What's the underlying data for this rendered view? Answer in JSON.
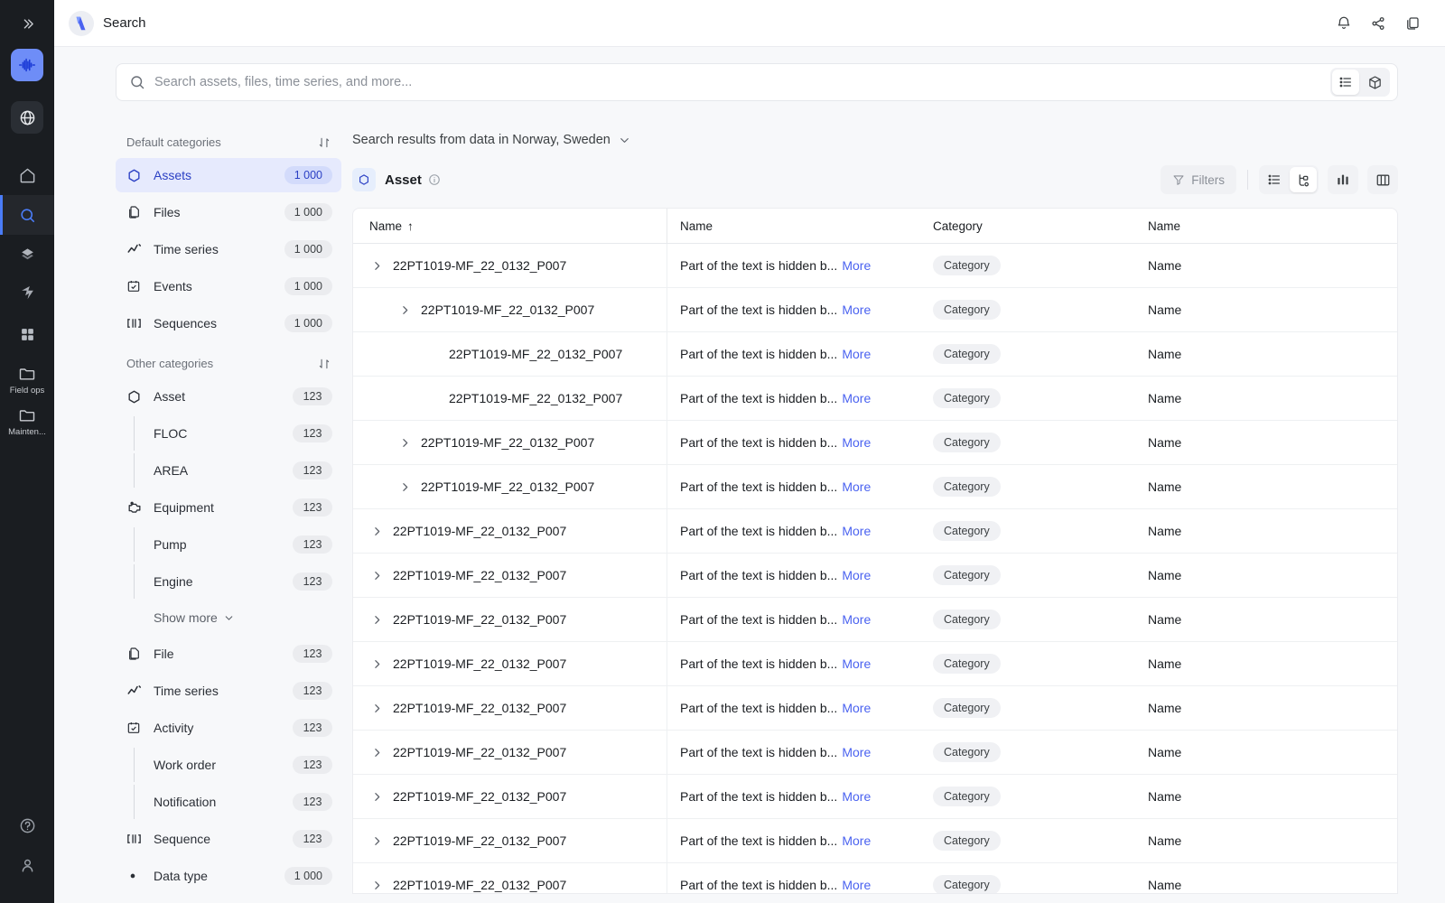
{
  "rail": {
    "collapse_icon": "chevrons-right-icon",
    "brand_icon": "cognite-brand-icon",
    "globe_icon": "globe-icon",
    "items": [
      {
        "icon": "home-icon",
        "name": "home",
        "active": false
      },
      {
        "icon": "search-icon",
        "name": "search",
        "active": true
      },
      {
        "icon": "layers-icon",
        "name": "layers",
        "active": false
      },
      {
        "icon": "activity-icon",
        "name": "activity",
        "active": false
      },
      {
        "icon": "grid-icon",
        "name": "apps",
        "active": false
      }
    ],
    "folders": [
      {
        "label": "Field ops",
        "icon": "folder-icon"
      },
      {
        "label": "Mainten...",
        "icon": "folder-icon"
      }
    ],
    "bottom": [
      {
        "icon": "help-icon",
        "name": "help"
      },
      {
        "icon": "user-icon",
        "name": "profile"
      }
    ]
  },
  "topbar": {
    "title": "Search",
    "logo_icon": "cognite-logo-icon",
    "actions": [
      {
        "icon": "bell-icon",
        "name": "notifications"
      },
      {
        "icon": "share-icon",
        "name": "share"
      },
      {
        "icon": "copy-icon",
        "name": "files"
      }
    ]
  },
  "search": {
    "placeholder": "Search assets, files, time series, and more...",
    "value": "",
    "icon": "search-icon",
    "view_toggle": [
      {
        "icon": "list-icon",
        "name": "list-view",
        "active": true
      },
      {
        "icon": "cube-icon",
        "name": "3d-view",
        "active": false
      }
    ]
  },
  "categories": {
    "default_header": "Default categories",
    "other_header": "Other categories",
    "sort_icon": "sort-icon",
    "default_items": [
      {
        "label": "Assets",
        "count": "1 000",
        "icon": "hexagon-icon",
        "selected": true,
        "child": false
      },
      {
        "label": "Files",
        "count": "1 000",
        "icon": "file-icon",
        "selected": false,
        "child": false
      },
      {
        "label": "Time series",
        "count": "1 000",
        "icon": "timeseries-icon",
        "selected": false,
        "child": false
      },
      {
        "label": "Events",
        "count": "1 000",
        "icon": "event-icon",
        "selected": false,
        "child": false
      },
      {
        "label": "Sequences",
        "count": "1 000",
        "icon": "sequence-icon",
        "selected": false,
        "child": false
      }
    ],
    "other_items": [
      {
        "label": "Asset",
        "count": "123",
        "icon": "hexagon-icon",
        "selected": false,
        "child": false
      },
      {
        "label": "FLOC",
        "count": "123",
        "icon": "",
        "selected": false,
        "child": true
      },
      {
        "label": "AREA",
        "count": "123",
        "icon": "",
        "selected": false,
        "child": true
      },
      {
        "label": "Equipment",
        "count": "123",
        "icon": "equipment-icon",
        "selected": false,
        "child": false
      },
      {
        "label": "Pump",
        "count": "123",
        "icon": "",
        "selected": false,
        "child": true
      },
      {
        "label": "Engine",
        "count": "123",
        "icon": "",
        "selected": false,
        "child": true
      }
    ],
    "show_more": "Show more",
    "show_more_icon": "chevron-down-icon",
    "other_items_2": [
      {
        "label": "File",
        "count": "123",
        "icon": "file-icon",
        "selected": false,
        "child": false
      },
      {
        "label": "Time series",
        "count": "123",
        "icon": "timeseries-icon",
        "selected": false,
        "child": false
      },
      {
        "label": "Activity",
        "count": "123",
        "icon": "event-icon",
        "selected": false,
        "child": false
      },
      {
        "label": "Work order",
        "count": "123",
        "icon": "",
        "selected": false,
        "child": true
      },
      {
        "label": "Notification",
        "count": "123",
        "icon": "",
        "selected": false,
        "child": true
      },
      {
        "label": "Sequence",
        "count": "123",
        "icon": "sequence-icon",
        "selected": false,
        "child": false
      },
      {
        "label": "Data type",
        "count": "1 000",
        "icon": "dot-icon",
        "selected": false,
        "child": false
      }
    ]
  },
  "results": {
    "scope_label": "Search results from data in Norway, Sweden",
    "scope_chevron": "chevron-down-icon",
    "type_label": "Asset",
    "type_icon": "hexagon-icon",
    "info_icon": "info-icon",
    "filters_label": "Filters",
    "filters_icon": "filter-icon",
    "view_buttons": [
      {
        "icon": "list-icon",
        "name": "list-view",
        "active": false
      },
      {
        "icon": "tree-icon",
        "name": "tree-view",
        "active": true
      },
      {
        "icon": "chart-icon",
        "name": "chart-view",
        "active": false
      },
      {
        "icon": "columns-icon",
        "name": "columns-view",
        "active": false
      }
    ],
    "columns": [
      {
        "label": "Name",
        "sort": "↑"
      },
      {
        "label": "Name",
        "sort": ""
      },
      {
        "label": "Category",
        "sort": ""
      },
      {
        "label": "Name",
        "sort": ""
      }
    ],
    "row_name": "22PT1019-MF_22_0132_P007",
    "row_desc": "Part of the text is hidden b...",
    "row_more": "More",
    "row_category": "Category",
    "row_last": "Name",
    "rows": [
      {
        "depth": 0,
        "caret": true
      },
      {
        "depth": 1,
        "caret": true
      },
      {
        "depth": 2,
        "caret": false
      },
      {
        "depth": 2,
        "caret": false
      },
      {
        "depth": 1,
        "caret": true
      },
      {
        "depth": 1,
        "caret": true
      },
      {
        "depth": 0,
        "caret": true
      },
      {
        "depth": 0,
        "caret": true
      },
      {
        "depth": 0,
        "caret": true
      },
      {
        "depth": 0,
        "caret": true
      },
      {
        "depth": 0,
        "caret": true
      },
      {
        "depth": 0,
        "caret": true
      },
      {
        "depth": 0,
        "caret": true
      },
      {
        "depth": 0,
        "caret": true
      },
      {
        "depth": 0,
        "caret": true
      }
    ]
  },
  "colors": {
    "accent": "#4a62f0",
    "selected_bg": "#e6eafd",
    "rail_bg": "#1a1d21",
    "page_bg": "#f7f8fa"
  }
}
